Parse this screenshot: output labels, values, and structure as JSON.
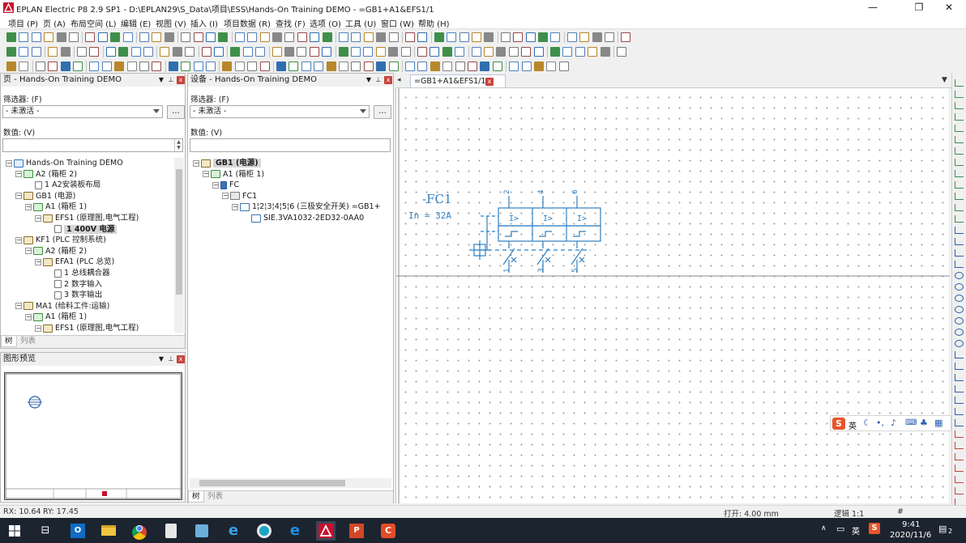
{
  "window": {
    "title": "EPLAN Electric P8 2.9 SP1 - D:\\EPLAN29\\S_Data\\项目\\ESS\\Hands-On Training DEMO - =GB1+A1&EFS1/1",
    "minimize": "—",
    "maximize": "❐",
    "close": "✕"
  },
  "menu": [
    "项目 (P)",
    "页 (A)",
    "布局空间 (L)",
    "编辑 (E)",
    "视图 (V)",
    "插入 (I)",
    "项目数据 (R)",
    "查找 (F)",
    "选项 (O)",
    "工具 (U)",
    "窗口 (W)",
    "帮助 (H)"
  ],
  "pages_panel": {
    "title": "页 - Hands-On Training DEMO",
    "filter_label": "筛选器: (F)",
    "filter_value": "- 未激活 -",
    "more_button": "...",
    "value_label": "数值: (V)",
    "tree": [
      {
        "text": "Hands-On Training DEMO",
        "level": 0,
        "icon": "proj",
        "exp": "−"
      },
      {
        "text": "A2 (箱柜 2)",
        "level": 1,
        "icon": "loc",
        "exp": "−"
      },
      {
        "text": "1 A2安装板布局",
        "level": 2,
        "icon": "page",
        "exp": ""
      },
      {
        "text": "GB1 (电源)",
        "level": 1,
        "icon": "func",
        "exp": "−"
      },
      {
        "text": "A1 (箱柜 1)",
        "level": 2,
        "icon": "loc",
        "exp": "−"
      },
      {
        "text": "EFS1 (原理图,电气工程)",
        "level": 3,
        "icon": "func",
        "exp": "−"
      },
      {
        "text": "1 400V 电源",
        "level": 4,
        "icon": "page",
        "exp": "",
        "selected": true
      },
      {
        "text": "KF1 (PLC 控制系统)",
        "level": 1,
        "icon": "func",
        "exp": "−"
      },
      {
        "text": "A2 (箱柜 2)",
        "level": 2,
        "icon": "loc",
        "exp": "−"
      },
      {
        "text": "EFA1 (PLC 总览)",
        "level": 3,
        "icon": "func",
        "exp": "−"
      },
      {
        "text": "1 总线耦合器",
        "level": 4,
        "icon": "page",
        "exp": ""
      },
      {
        "text": "2 数字输入",
        "level": 4,
        "icon": "page",
        "exp": ""
      },
      {
        "text": "3 数字输出",
        "level": 4,
        "icon": "page",
        "exp": ""
      },
      {
        "text": "MA1 (给料工件:运输)",
        "level": 1,
        "icon": "func",
        "exp": "−"
      },
      {
        "text": "A1 (箱柜 1)",
        "level": 2,
        "icon": "loc",
        "exp": "−"
      },
      {
        "text": "EFS1 (原理图,电气工程)",
        "level": 3,
        "icon": "func",
        "exp": "−"
      }
    ],
    "tabs": [
      "树",
      "列表"
    ]
  },
  "preview_panel": {
    "title": "图形预览"
  },
  "devices_panel": {
    "title": "设备 - Hands-On Training DEMO",
    "filter_label": "筛选器: (F)",
    "filter_value": "- 未激活 -",
    "more_button": "...",
    "value_label": "数值: (V)",
    "tree": [
      {
        "text": "GB1 (电源)",
        "level": 0,
        "icon": "func",
        "exp": "−",
        "selected": true
      },
      {
        "text": "A1 (箱柜 1)",
        "level": 1,
        "icon": "loc",
        "exp": "−"
      },
      {
        "text": "FC",
        "level": 2,
        "icon": "dev",
        "exp": "−"
      },
      {
        "text": "FC1",
        "level": 3,
        "icon": "dev2",
        "exp": "−"
      },
      {
        "text": "1¦2¦3¦4¦5¦6 (三极安全开关) =GB1+",
        "level": 4,
        "icon": "part",
        "exp": "−"
      },
      {
        "text": "SIE.3VA1032-2ED32-0AA0",
        "level": 5,
        "icon": "part",
        "exp": ""
      }
    ],
    "tabs": [
      "树",
      "列表"
    ]
  },
  "document": {
    "tab": "=GB1+A1&EFS1/1",
    "tab_close": "x",
    "dropdown": "▼"
  },
  "schematic": {
    "tag": "-FC1",
    "rating": "In = 32A",
    "top_terminals": [
      "2",
      "4",
      "6"
    ],
    "bottom_terminals": [
      "1",
      "3",
      "5"
    ],
    "trip_label": "I>"
  },
  "status": {
    "rx": "RX: 10.64",
    "ry": "RY: 17.45",
    "open": "打开: 4.00 mm",
    "logic": "逻辑 1:1",
    "hash": "#"
  },
  "taskbar": {
    "time": "9:41",
    "date": "2020/11/6",
    "ime": "英",
    "notifications": "2"
  },
  "ime_bar": {
    "mode": "英"
  },
  "colors": {
    "accent": "#2f7fc2",
    "epolan_red": "#c8102e",
    "schematic_blue": "#2f7fc2",
    "taskbar": "#1c2430"
  }
}
